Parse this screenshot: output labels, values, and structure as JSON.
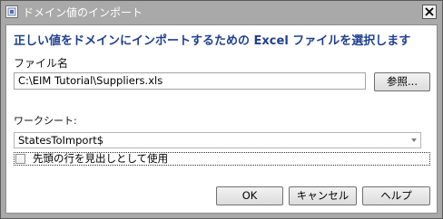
{
  "window": {
    "title": "ドメイン値のインポート",
    "icon": "app-icon",
    "close_icon": "close-icon"
  },
  "dialog": {
    "heading": "正しい値をドメインにインポートするための Excel ファイルを選択します",
    "file_label": "ファイル名",
    "file_path": "C:\\EIM Tutorial\\Suppliers.xls",
    "browse_label": "参照...",
    "worksheet_label": "ワークシート:",
    "worksheet_selected": "StatesToImport$",
    "header_checkbox_label": "先頭の行を見出しとして使用",
    "header_checkbox_checked": false
  },
  "buttons": {
    "ok": "OK",
    "cancel": "キャンセル",
    "help": "ヘルプ"
  },
  "colors": {
    "heading": "#1f3f8f",
    "titlebar": "#a9a9a9"
  }
}
